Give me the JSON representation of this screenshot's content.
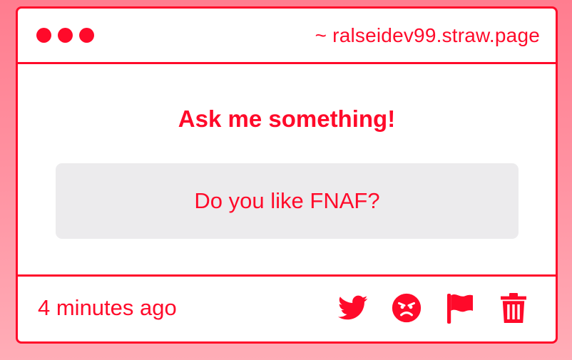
{
  "window": {
    "url": "~ ralseidev99.straw.page"
  },
  "main": {
    "heading": "Ask me something!",
    "question": "Do you like FNAF?"
  },
  "footer": {
    "timestamp": "4 minutes ago",
    "actions": [
      {
        "icon": "twitter-icon"
      },
      {
        "icon": "angry-face-icon"
      },
      {
        "icon": "flag-icon"
      },
      {
        "icon": "trash-icon"
      }
    ]
  },
  "colors": {
    "accent": "#ff0a2a",
    "question_bg": "#ecebed",
    "background_top": "#ff7d8f",
    "background_bottom": "#ffadb7"
  }
}
